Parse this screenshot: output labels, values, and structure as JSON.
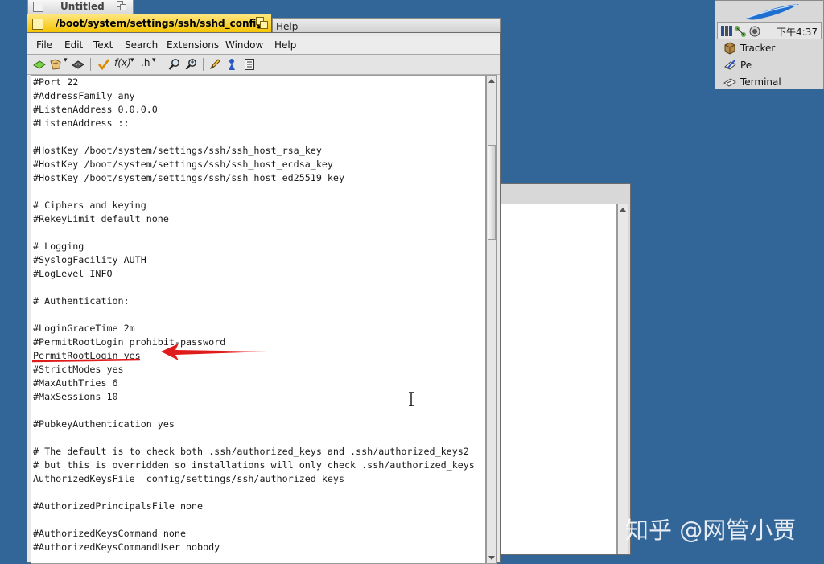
{
  "background_window": {
    "title": "Untitled"
  },
  "editor_window": {
    "title": "/boot/system/settings/ssh/sshd_config",
    "peek_menu": "Help"
  },
  "menubar": [
    "File",
    "Edit",
    "Text",
    "Search",
    "Extensions",
    "Window",
    "Help"
  ],
  "toolbar": {
    "function_label": "f(x)",
    "header_label": ".h"
  },
  "code_lines": [
    "#Port 22",
    "#AddressFamily any",
    "#ListenAddress 0.0.0.0",
    "#ListenAddress ::",
    "",
    "#HostKey /boot/system/settings/ssh/ssh_host_rsa_key",
    "#HostKey /boot/system/settings/ssh/ssh_host_ecdsa_key",
    "#HostKey /boot/system/settings/ssh/ssh_host_ed25519_key",
    "",
    "# Ciphers and keying",
    "#RekeyLimit default none",
    "",
    "# Logging",
    "#SyslogFacility AUTH",
    "#LogLevel INFO",
    "",
    "# Authentication:",
    "",
    "#LoginGraceTime 2m",
    "#PermitRootLogin prohibit-password",
    "PermitRootLogin yes",
    "#StrictModes yes",
    "#MaxAuthTries 6",
    "#MaxSessions 10",
    "",
    "#PubkeyAuthentication yes",
    "",
    "# The default is to check both .ssh/authorized_keys and .ssh/authorized_keys2",
    "# but this is overridden so installations will only check .ssh/authorized_keys",
    "AuthorizedKeysFile  config/settings/ssh/authorized_keys",
    "",
    "#AuthorizedPrincipalsFile none",
    "",
    "#AuthorizedKeysCommand none",
    "#AuthorizedKeysCommandUser nobody"
  ],
  "deskbar": {
    "clock": "下午4:37",
    "items": [
      "Tracker",
      "Pe",
      "Terminal"
    ]
  },
  "watermark": "知乎 @网管小贾",
  "colors": {
    "desktop": "#336698",
    "active_tab": "#f5c400",
    "annotation": "#e01b1b"
  }
}
